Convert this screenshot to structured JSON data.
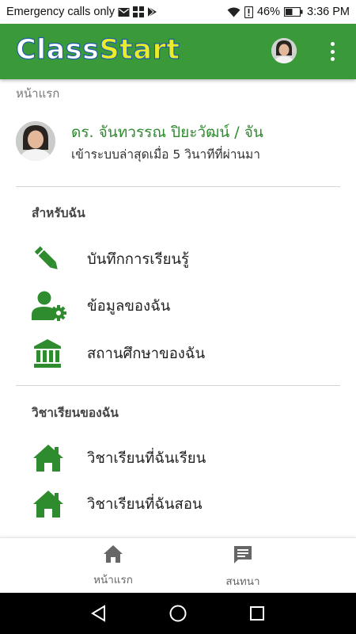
{
  "statusbar": {
    "carrier_text": "Emergency calls only",
    "battery": "46%",
    "time": "3:36 PM"
  },
  "appbar": {
    "logo_part1": "Class",
    "logo_part2": "Start"
  },
  "breadcrumb": "หน้าแรก",
  "profile": {
    "name": "ดร. จันทวรรณ ปิยะวัฒน์ / จัน",
    "last_login": "เข้าระบบล่าสุดเมื่อ 5 วินาทีที่ผ่านมา"
  },
  "section_for_me": {
    "title": "สำหรับฉัน",
    "items": [
      {
        "label": "บันทึกการเรียนรู้",
        "icon": "pencil-icon"
      },
      {
        "label": "ข้อมูลของฉัน",
        "icon": "user-settings-icon"
      },
      {
        "label": "สถานศึกษาของฉัน",
        "icon": "institution-icon"
      }
    ]
  },
  "section_my_courses": {
    "title": "วิชาเรียนของฉัน",
    "items": [
      {
        "label": "วิชาเรียนที่ฉันเรียน",
        "icon": "home-icon"
      },
      {
        "label": "วิชาเรียนที่ฉันสอน",
        "icon": "home-icon"
      }
    ]
  },
  "bottom_nav": {
    "home_label": "หน้าแรก",
    "chat_label": "สนทนา"
  },
  "colors": {
    "primary_green": "#3a9a3a",
    "icon_green": "#2e8b2e",
    "logo_yellow": "#e9ec2a"
  }
}
